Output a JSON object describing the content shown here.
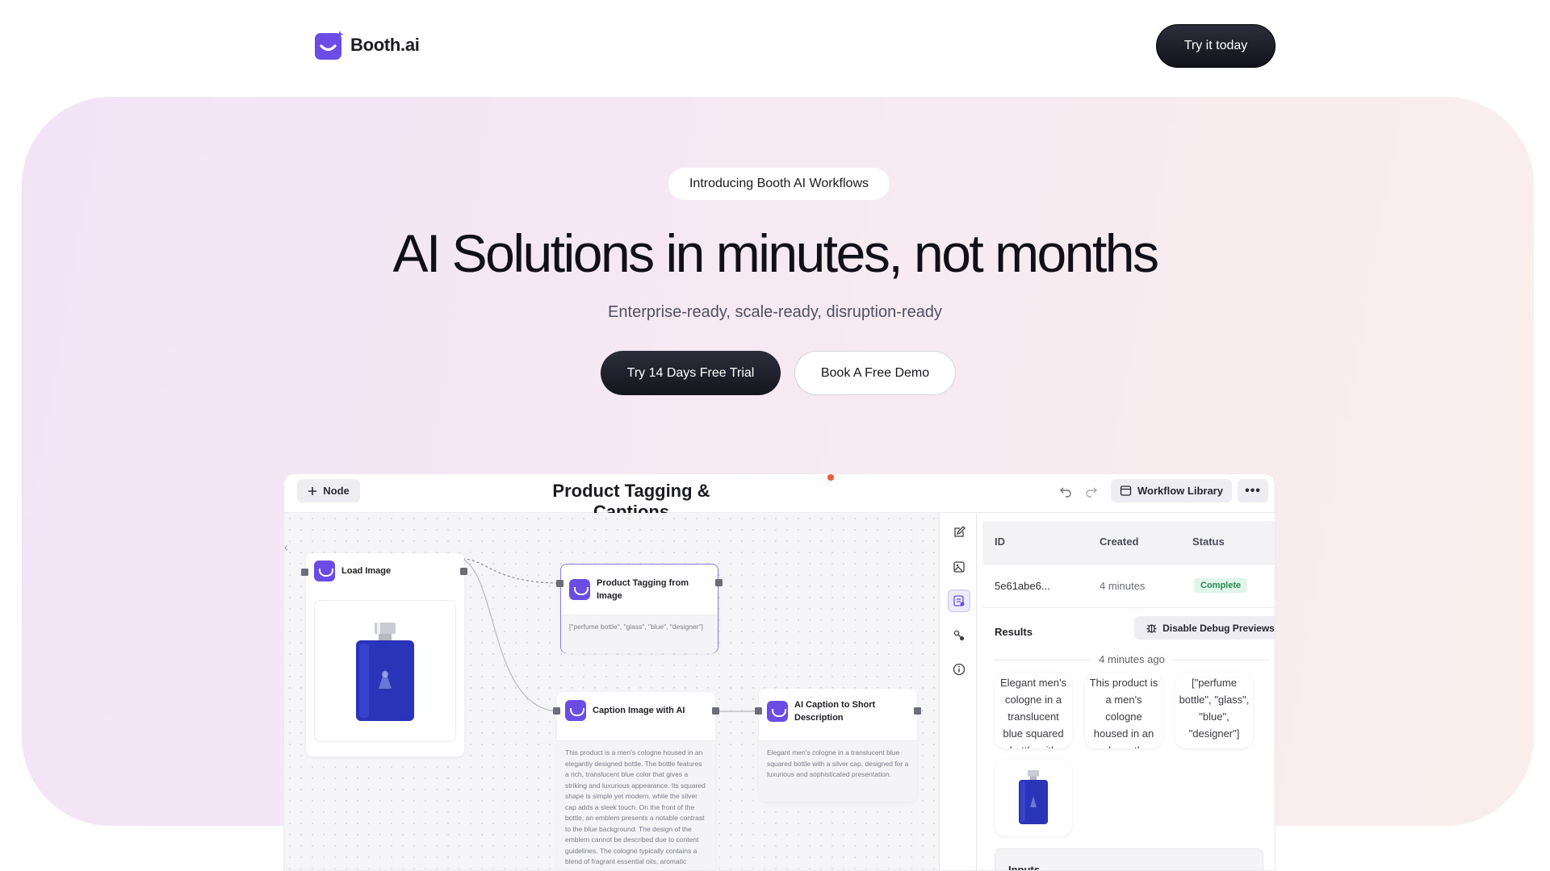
{
  "brand": {
    "name": "Booth.ai"
  },
  "nav": {
    "cta": "Try it today"
  },
  "hero": {
    "pill": "Introducing Booth AI Workflows",
    "title": "AI Solutions in minutes, not months",
    "subtitle": "Enterprise-ready, scale-ready, disruption-ready",
    "primary_cta": "Try 14 Days Free Trial",
    "secondary_cta": "Book A Free Demo"
  },
  "app": {
    "node_button": "Node",
    "title": "Product Tagging & Captions",
    "workflow_library": "Workflow Library",
    "nodes": {
      "load_image": {
        "title": "Load Image"
      },
      "tagging": {
        "title": "Product Tagging from Image",
        "output": "[\"perfume bottle\", \"glass\", \"blue\", \"designer\"]"
      },
      "caption": {
        "title": "Caption Image with AI",
        "output": "This product is a men's cologne housed in an elegantly designed bottle. The bottle features a rich, translucent blue color that gives a striking and luxurious appearance. Its squared shape is simple yet modern, while the silver cap adds a sleek touch. On the front of the bottle, an emblem presents a notable contrast to the blue background. The design of the emblem cannot be described due to content guidelines. The cologne typically contains a blend of fragrant essential oils, aromatic"
      },
      "short_desc": {
        "title": "AI Caption to Short Description",
        "output": "Elegant men's cologne in a translucent blue squared bottle with a silver cap, designed for a luxurious and sophisticated presentation."
      }
    },
    "panel": {
      "headers": {
        "id": "ID",
        "created": "Created",
        "status": "Status"
      },
      "row": {
        "id": "5e61abe6...",
        "created": "4 minutes",
        "status": "Complete"
      },
      "results_label": "Results",
      "debug_button": "Disable Debug Previews",
      "divider": "4 minutes ago",
      "cards": [
        "Elegant men's cologne in a translucent blue squared bottle with",
        "This product is a men's cologne housed in an elegantly",
        "[\"perfume bottle\", \"glass\", \"blue\", \"designer\"]"
      ],
      "inputs_label": "Inputs"
    }
  },
  "colors": {
    "accent": "#6b4de6",
    "dark": "#14151d",
    "success": "#2c8a55",
    "hero_from": "#f2e4f6",
    "hero_to": "#faeeec"
  },
  "icons": [
    "logo-icon",
    "plus-icon",
    "undo-icon",
    "redo-icon",
    "library-icon",
    "more-icon",
    "edit-icon",
    "image-icon",
    "list-icon",
    "nodes-icon",
    "info-icon",
    "bug-icon",
    "chevron-left-icon"
  ]
}
